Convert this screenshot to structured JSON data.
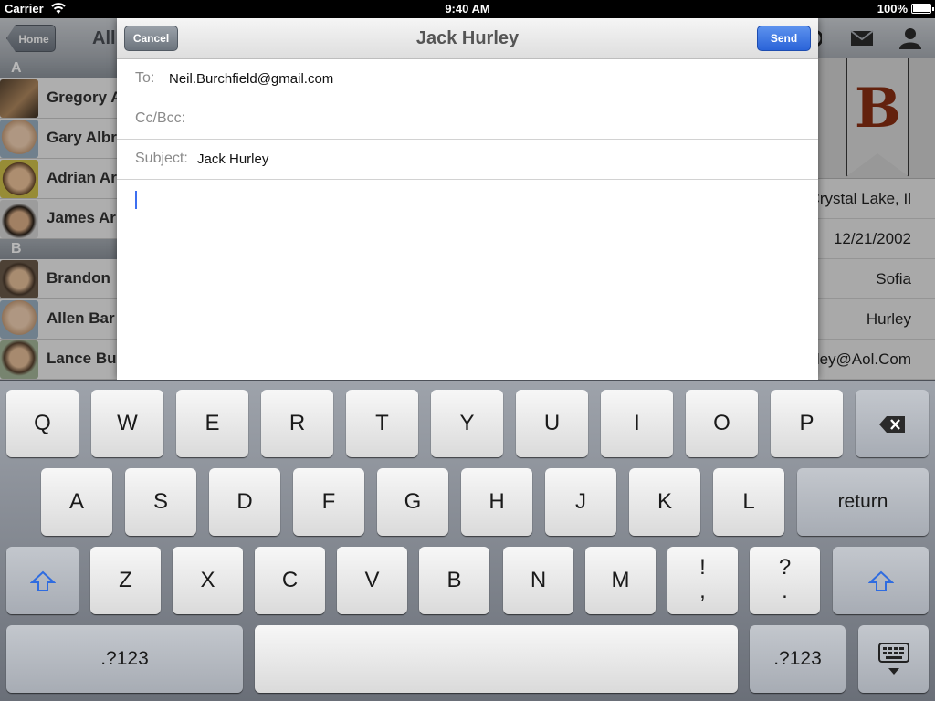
{
  "status_bar": {
    "carrier": "Carrier",
    "time": "9:40 AM",
    "battery": "100%"
  },
  "background_app": {
    "home_button": "Home",
    "nav_title": "All",
    "contacts": [
      {
        "section": "A",
        "items": [
          "Gregory A",
          "Gary Albr",
          "Adrian Ar",
          "James Ar"
        ]
      },
      {
        "section": "B",
        "items": [
          "Brandon",
          "Allen Bar",
          "Lance Bu"
        ]
      }
    ],
    "detail": {
      "ribbon_letter": "B",
      "rows": [
        "Crystal Lake, Il",
        "12/21/2002",
        "Sofia",
        "Hurley",
        "Hurley@Aol.Com"
      ]
    }
  },
  "compose": {
    "cancel_label": "Cancel",
    "send_label": "Send",
    "title": "Jack Hurley",
    "to_label": "To:",
    "to_value": "Neil.Burchfield@gmail.com",
    "ccbcc_label": "Cc/Bcc:",
    "subject_label": "Subject:",
    "subject_value": "Jack Hurley",
    "body": ""
  },
  "keyboard": {
    "row1": [
      "Q",
      "W",
      "E",
      "R",
      "T",
      "Y",
      "U",
      "I",
      "O",
      "P"
    ],
    "row2": [
      "A",
      "S",
      "D",
      "F",
      "G",
      "H",
      "J",
      "K",
      "L"
    ],
    "row3": [
      "Z",
      "X",
      "C",
      "V",
      "B",
      "N",
      "M"
    ],
    "punct1_top": "!",
    "punct1_bottom": ",",
    "punct2_top": "?",
    "punct2_bottom": ".",
    "return_label": "return",
    "numbers_label": ".?123",
    "icons": {
      "backspace": "backspace-icon",
      "shift": "shift-icon",
      "hide": "keyboard-hide-icon"
    },
    "accent_color": "#2f6ce0"
  }
}
